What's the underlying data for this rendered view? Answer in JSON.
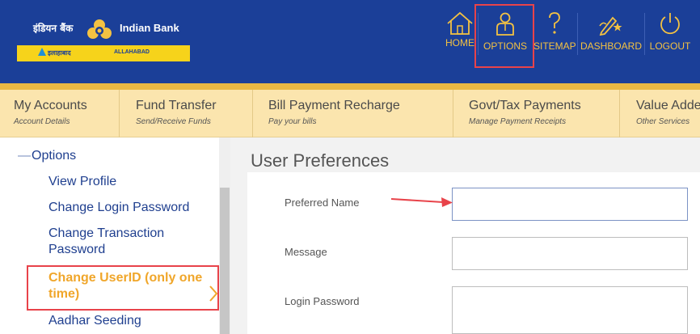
{
  "brand": {
    "hindi_name": "इंडियन बैंक",
    "english_name": "Indian Bank",
    "sub_hindi": "इलाहाबाद",
    "sub_english": "ALLAHABAD",
    "color_primary": "#1b3f98",
    "color_accent": "#f4c242"
  },
  "top_nav": [
    {
      "label": "HOME",
      "icon": "home-icon"
    },
    {
      "label": "OPTIONS",
      "icon": "user-icon"
    },
    {
      "label": "SITEMAP",
      "icon": "question-icon"
    },
    {
      "label": "DASHBOARD",
      "icon": "pen-star-icon"
    },
    {
      "label": "LOGOUT",
      "icon": "power-icon"
    }
  ],
  "menubar": [
    {
      "title": "My Accounts",
      "subtitle": "Account Details"
    },
    {
      "title": "Fund Transfer",
      "subtitle": "Send/Receive Funds"
    },
    {
      "title": "Bill Payment Recharge",
      "subtitle": "Pay your bills"
    },
    {
      "title": "Govt/Tax Payments",
      "subtitle": "Manage Payment Receipts"
    },
    {
      "title": "Value Adde",
      "subtitle": "Other Services"
    }
  ],
  "sidebar": {
    "section_toggle": "—",
    "section_label": "Options",
    "items": [
      {
        "line1": "View Profile",
        "line2": ""
      },
      {
        "line1": "Change Login Password",
        "line2": ""
      },
      {
        "line1": "Change Transaction",
        "line2": "Password"
      },
      {
        "line1": "Change UserID (only one",
        "line2": "time)"
      },
      {
        "line1": "Aadhar Seeding",
        "line2": ""
      }
    ],
    "active_index": 3
  },
  "main": {
    "title": "User Preferences",
    "fields": [
      {
        "label": "Preferred Name",
        "value": "",
        "placeholder": ""
      },
      {
        "label": "Message",
        "value": "",
        "placeholder": ""
      },
      {
        "label": "Login Password",
        "value": "",
        "placeholder": ""
      }
    ]
  }
}
